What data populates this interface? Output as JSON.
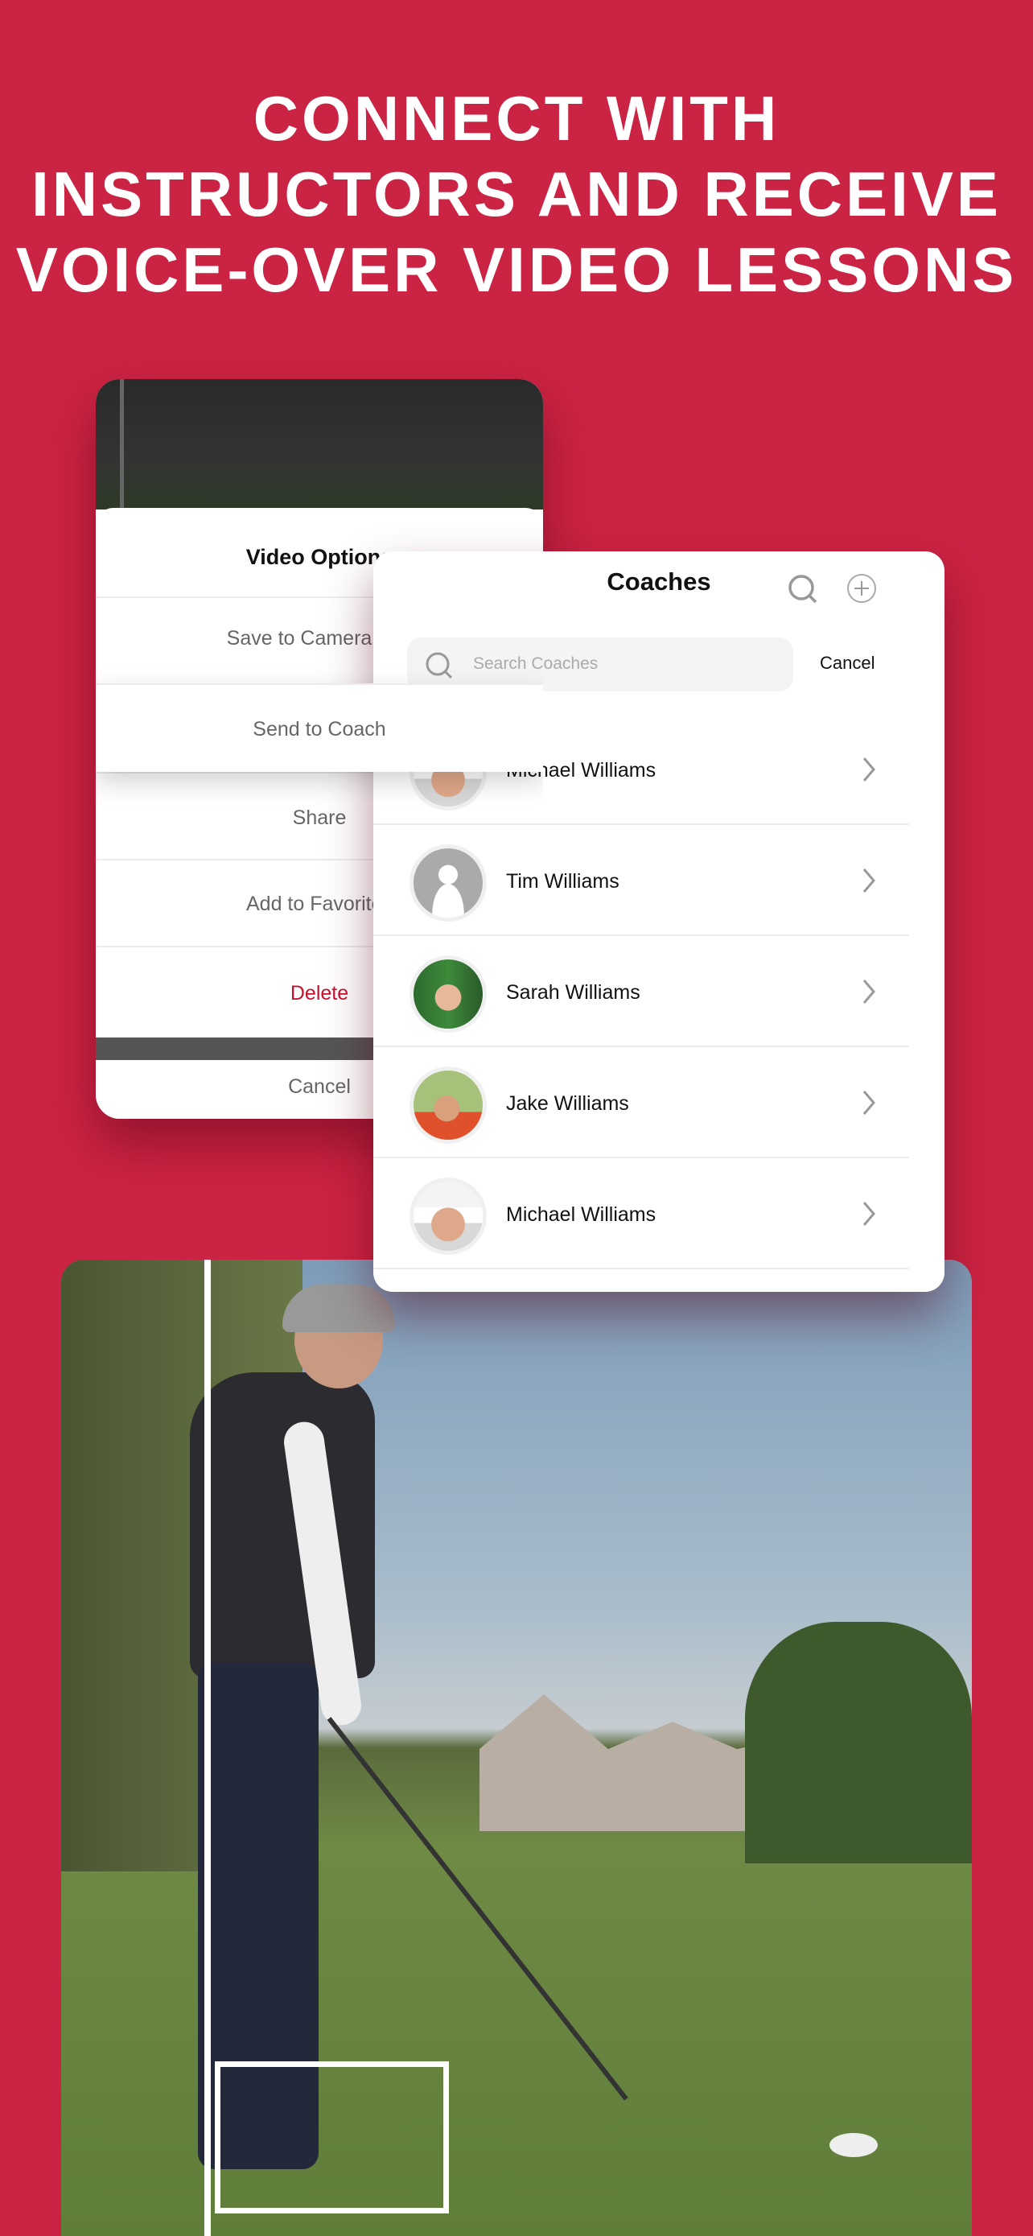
{
  "headline": [
    "CONNECT WITH",
    "INSTRUCTORS AND RECEIVE",
    "VOICE-OVER VIDEO LESSONS"
  ],
  "video_options": {
    "title": "Video Options",
    "items": [
      {
        "label": "Save to Camera Roll"
      },
      {
        "label": "Send to Coach"
      },
      {
        "label": "Share"
      },
      {
        "label": "Add to Favorites"
      },
      {
        "label": "Delete",
        "color": "#c8102e"
      }
    ],
    "cancel": "Cancel"
  },
  "coaches": {
    "title": "Coaches",
    "search_placeholder": "Search Coaches",
    "cancel": "Cancel",
    "list": [
      {
        "name": "Michael Williams",
        "avatar": "photo"
      },
      {
        "name": "Tim Williams",
        "avatar": "placeholder"
      },
      {
        "name": "Sarah Williams",
        "avatar": "photo"
      },
      {
        "name": "Jake Williams",
        "avatar": "photo"
      },
      {
        "name": "Michael Williams",
        "avatar": "photo"
      }
    ]
  },
  "colors": {
    "background": "#cb2343",
    "delete": "#c8102e"
  }
}
